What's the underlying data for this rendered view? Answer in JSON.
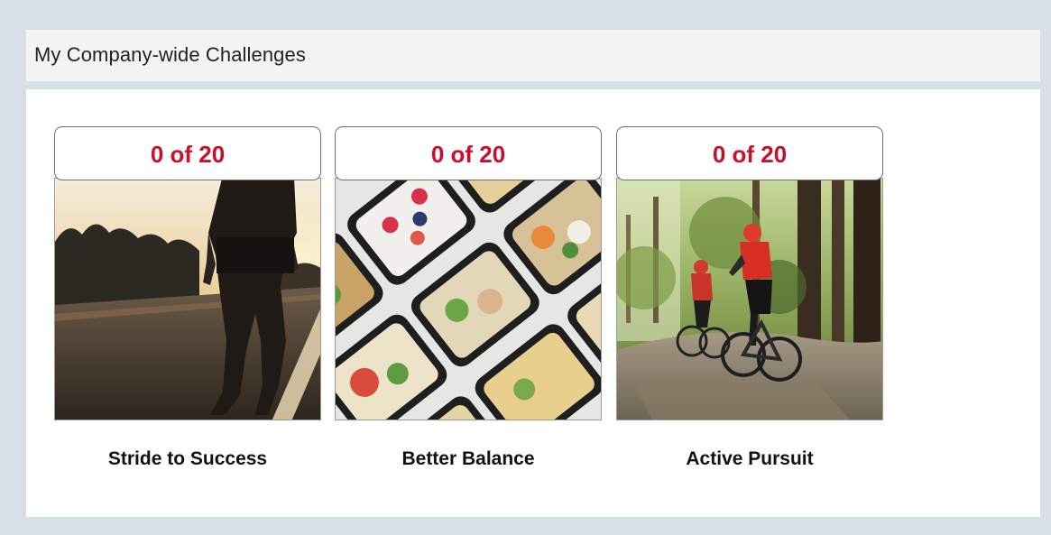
{
  "panel": {
    "title": "My Company-wide Challenges"
  },
  "challenges": [
    {
      "progress": "0 of 20",
      "name": "Stride to Success",
      "image": "runner-on-road-at-sunset"
    },
    {
      "progress": "0 of 20",
      "name": "Better Balance",
      "image": "meal-prep-containers"
    },
    {
      "progress": "0 of 20",
      "name": "Active Pursuit",
      "image": "mountain-bikers-in-forest"
    }
  ],
  "colors": {
    "progress": "#c8102e",
    "page_background": "#d9dfe6",
    "header_background": "#f4f4f4"
  }
}
